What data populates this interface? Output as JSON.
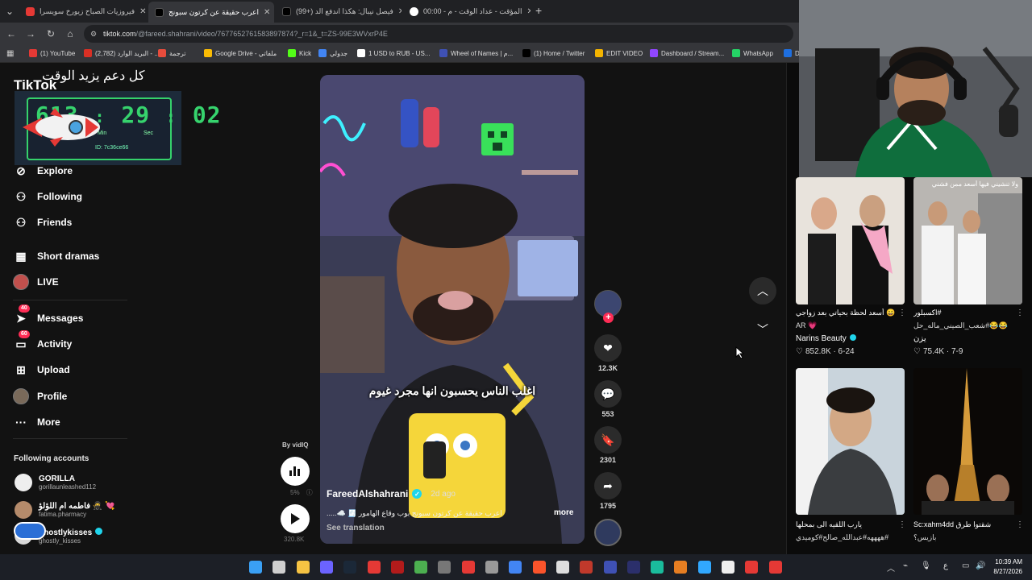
{
  "browser": {
    "tabs": [
      {
        "title": "فيروزيات الصباح زيورخ سويسرا",
        "color": "#e53935",
        "active": false
      },
      {
        "title": "اعرب حقيقة عن كرتون سبونج",
        "color": "#111111",
        "active": true
      },
      {
        "title": "(99+) فيصل نيبال: هكذا اندفع الد",
        "color": "#111111",
        "active": false
      },
      {
        "title": "00:00 - المؤقت - عداد الوقت - م",
        "color": "#ffffff",
        "active": false
      }
    ],
    "new_tab": "+",
    "url_host": "tiktok.com",
    "url_path": "/@fareed.shahrani/video/7677652761583897874?_r=1&_t=ZS-99E3WVxrP4E",
    "bookmarks": [
      {
        "label": "(1) YouTube",
        "color": "#e53935"
      },
      {
        "label": "(2,782) البريد الوارد - ...",
        "color": "#d93025"
      },
      {
        "label": "ترجمة",
        "color": "#e74c3c"
      },
      {
        "label": "Google Drive - ملفاتي",
        "color": "#fbbc04"
      },
      {
        "label": "Kick",
        "color": "#53fc18"
      },
      {
        "label": "جدولي",
        "color": "#4285f4"
      },
      {
        "label": "1 USD to RUB - US...",
        "color": "#ffffff"
      },
      {
        "label": "Wheel of Names | م...",
        "color": "#3f51b5"
      },
      {
        "label": "(1) Home / Twitter",
        "color": "#000000"
      },
      {
        "label": "EDIT VIDEO",
        "color": "#f4b400"
      },
      {
        "label": "Dashboard / Stream...",
        "color": "#9146ff"
      },
      {
        "label": "WhatsApp",
        "color": "#25d366"
      },
      {
        "label": "D",
        "color": "#1e6fe0"
      }
    ]
  },
  "overlay": {
    "title": "كل دعم يزيد الوقت",
    "timer_hours": "613",
    "timer_minutes": "29",
    "timer_seconds": "02",
    "sep": ":",
    "sec_label": "Sec",
    "min_label": "Min",
    "id_label": "ID: 7c36ce66"
  },
  "sidebar": {
    "logo": "TikTok",
    "items": [
      {
        "label": "Explore",
        "icon": "compass-icon",
        "badge": ""
      },
      {
        "label": "Following",
        "icon": "user-follow-icon",
        "badge": ""
      },
      {
        "label": "Friends",
        "icon": "friends-icon",
        "badge": ""
      },
      {
        "label": "Short dramas",
        "icon": "film-icon",
        "badge": ""
      },
      {
        "label": "LIVE",
        "icon": "live-avatar",
        "badge": ""
      },
      {
        "label": "Messages",
        "icon": "send-icon",
        "badge": "40"
      },
      {
        "label": "Activity",
        "icon": "inbox-icon",
        "badge": "60"
      },
      {
        "label": "Upload",
        "icon": "plus-icon",
        "badge": ""
      },
      {
        "label": "Profile",
        "icon": "profile-avatar",
        "badge": ""
      },
      {
        "label": "More",
        "icon": "more-icon",
        "badge": ""
      }
    ],
    "following_header": "Following accounts",
    "accounts": [
      {
        "name": "GORILLA",
        "handle": "gorillaunleashed112",
        "color": "#eeeeee",
        "verified": false
      },
      {
        "name": "فاطمه ام اللؤلؤ 🥷 💘",
        "handle": "fatima.pharmacy",
        "color": "#b58b6b",
        "verified": false
      },
      {
        "name": "ghostlykisses",
        "handle": "ghostly_kisses",
        "color": "#d8d8d8",
        "verified": true
      }
    ]
  },
  "video": {
    "caption_overlay": "اغلب الناس يحسبون انها مجرد غيوم",
    "author": "FareedAlshahrani",
    "age": "2d ago",
    "desc": "اعرب حقيقة عن كرتون سبونج بوب وقاع الهامور 🧾 ☁️.....",
    "more": "more",
    "translate": "See translation"
  },
  "actions": {
    "likes": "12.3K",
    "comments": "553",
    "saves": "2301",
    "shares": "1795"
  },
  "vidiq": {
    "by": "By vidIQ",
    "pct": "5%",
    "info": "ⓘ",
    "views": "320.8K"
  },
  "feed": [
    {
      "title": "😄 أسعد لحظة بحياتي بعد زواجي",
      "sub": "💗 AR",
      "author": "Narins Beauty",
      "stats": "852.8K · 6-24",
      "verified": true,
      "top_text": ""
    },
    {
      "title": "#اكسبلور",
      "sub": "😂😂#شعب_الصيني_ماله_حل",
      "author": "يزن",
      "stats": "75.4K · 7-9",
      "verified": false,
      "top_text": "ولا تنشيني فيها أسعد ممن فشني"
    },
    {
      "title": "يارب اللقيه الى بمحلها",
      "sub": "#ههههه#عبدالله_صالح#كوميدي",
      "author": "",
      "stats": "",
      "verified": false,
      "top_text": ""
    },
    {
      "title": "شقتوا طرق Sc:xahm4dd",
      "sub": "بازيس؟",
      "author": "",
      "stats": "",
      "verified": false,
      "top_text": ""
    }
  ],
  "clock": {
    "time": "10:39 AM",
    "date": "8/27/2026"
  },
  "tray": {
    "lang": "ع"
  }
}
